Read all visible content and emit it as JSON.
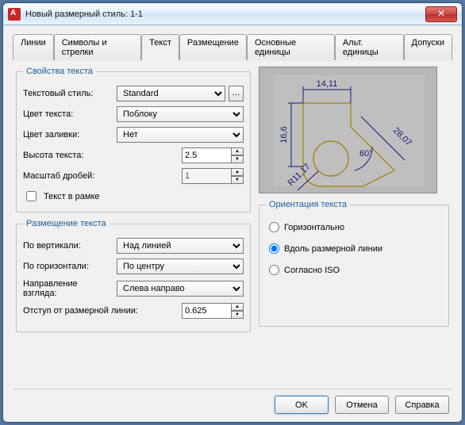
{
  "window": {
    "title": "Новый размерный стиль: 1-1"
  },
  "tabs": [
    "Линии",
    "Символы и стрелки",
    "Текст",
    "Размещение",
    "Основные единицы",
    "Альт. единицы",
    "Допуски"
  ],
  "activeTab": 2,
  "textProps": {
    "legend": "Свойства текста",
    "styleLabel": "Текстовый стиль:",
    "styleValue": "Standard",
    "colorLabel": "Цвет текста:",
    "colorValue": "Поблоку",
    "fillLabel": "Цвет заливки:",
    "fillValue": "Нет",
    "heightLabel": "Высота текста:",
    "heightValue": "2.5",
    "fracLabel": "Масштаб дробей:",
    "fracValue": "1",
    "frameLabel": "Текст в рамке"
  },
  "placement": {
    "legend": "Размещение текста",
    "vertLabel": "По вертикали:",
    "vertValue": "Над линией",
    "horizLabel": "По горизонтали:",
    "horizValue": "По центру",
    "dirLabel": "Направление взгляда:",
    "dirValue": "Слева направо",
    "offsetLabel": "Отступ от размерной линии:",
    "offsetValue": "0.625"
  },
  "orientation": {
    "legend": "Ориентация текста",
    "opt1": "Горизонтально",
    "opt2": "Вдоль размерной линии",
    "opt3": "Согласно ISO",
    "selected": 1
  },
  "preview": {
    "dim_top": "14,11",
    "dim_left": "16,6",
    "dim_right": "28,07",
    "dim_radius": "R11,17",
    "dim_angle": "60°"
  },
  "buttons": {
    "ok": "OK",
    "cancel": "Отмена",
    "help": "Справка"
  }
}
